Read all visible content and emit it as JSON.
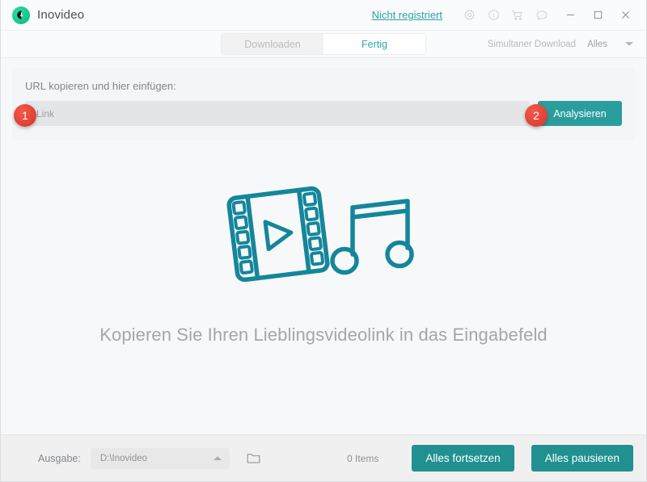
{
  "window": {
    "app_title": "Inovideo",
    "logo_icon": "download-circle-icon",
    "registration_link": "Nicht registriert",
    "toolbar_icons": [
      {
        "name": "gear-icon",
        "label": "Einstellungen"
      },
      {
        "name": "info-icon",
        "label": "Info"
      },
      {
        "name": "cart-icon",
        "label": "Kaufen"
      },
      {
        "name": "chat-icon",
        "label": "Feedback"
      }
    ],
    "controls": {
      "minimize": "minimize-icon",
      "maximize": "maximize-icon",
      "close": "close-icon"
    }
  },
  "tabs": [
    {
      "label": "Downloaden",
      "active": false
    },
    {
      "label": "Fertig",
      "active": true
    }
  ],
  "simultaneous": {
    "label": "Simultaner Download",
    "value": "Alles",
    "caret_icon": "chevron-down-icon"
  },
  "url_panel": {
    "label": "URL kopieren und hier einfügen:",
    "input_placeholder": "Link",
    "input_value": "",
    "analyze_label": "Analysieren",
    "badge_one": "1",
    "badge_two": "2"
  },
  "empty_state": {
    "illustration": "film-strip-and-music-note-icon",
    "message": "Kopieren Sie Ihren Lieblingsvideolink in das Eingabefeld"
  },
  "bottom_bar": {
    "output_label": "Ausgabe:",
    "output_path": "D:\\Inovideo",
    "caret_icon": "chevron-up-icon",
    "folder_icon": "folder-icon",
    "items_count": "0 Items",
    "resume_all_label": "Alles fortsetzen",
    "pause_all_label": "Alles pausieren"
  },
  "colors": {
    "accent_teal": "#2a9d9d",
    "button_teal": "#219090",
    "badge_red": "#e8443a",
    "logo_green": "#18ca8f",
    "illustration_teal": "#14869a",
    "page_bg": "#f7f8fa"
  }
}
